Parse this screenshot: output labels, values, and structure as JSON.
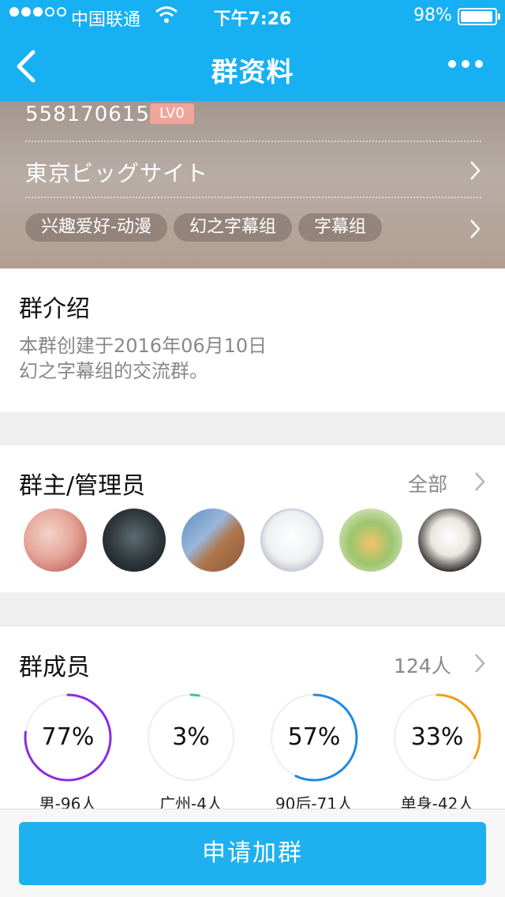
{
  "status_bar": {
    "carrier": "中国联通",
    "time": "下午7:26",
    "battery": "98%"
  },
  "nav": {
    "title": "群资料",
    "back_icon": "chevron-left-icon",
    "more_icon": "more-dots-icon"
  },
  "group": {
    "id": "558170615",
    "level": "LV0",
    "location": "東京ビッグサイト",
    "tags": [
      "兴趣爱好-动漫",
      "幻之字幕组",
      "字幕组"
    ]
  },
  "intro": {
    "title": "群介绍",
    "line1": "本群创建于2016年06月10日",
    "line2": "幻之字幕组的交流群。"
  },
  "admins": {
    "title": "群主/管理员",
    "all_label": "全部",
    "count_avatars": 6
  },
  "members": {
    "title": "群成员",
    "count": "124人",
    "stats": [
      {
        "percent_text": "77%",
        "value": 0.77,
        "label": "男-96人",
        "color": "#8a2be2"
      },
      {
        "percent_text": "3%",
        "value": 0.03,
        "label": "广州-4人",
        "color": "#2cc7b2"
      },
      {
        "percent_text": "57%",
        "value": 0.57,
        "label": "90后-71人",
        "color": "#1e88e5"
      },
      {
        "percent_text": "33%",
        "value": 0.33,
        "label": "单身-42人",
        "color": "#f39c12"
      }
    ]
  },
  "action": {
    "join_label": "申请加群"
  }
}
